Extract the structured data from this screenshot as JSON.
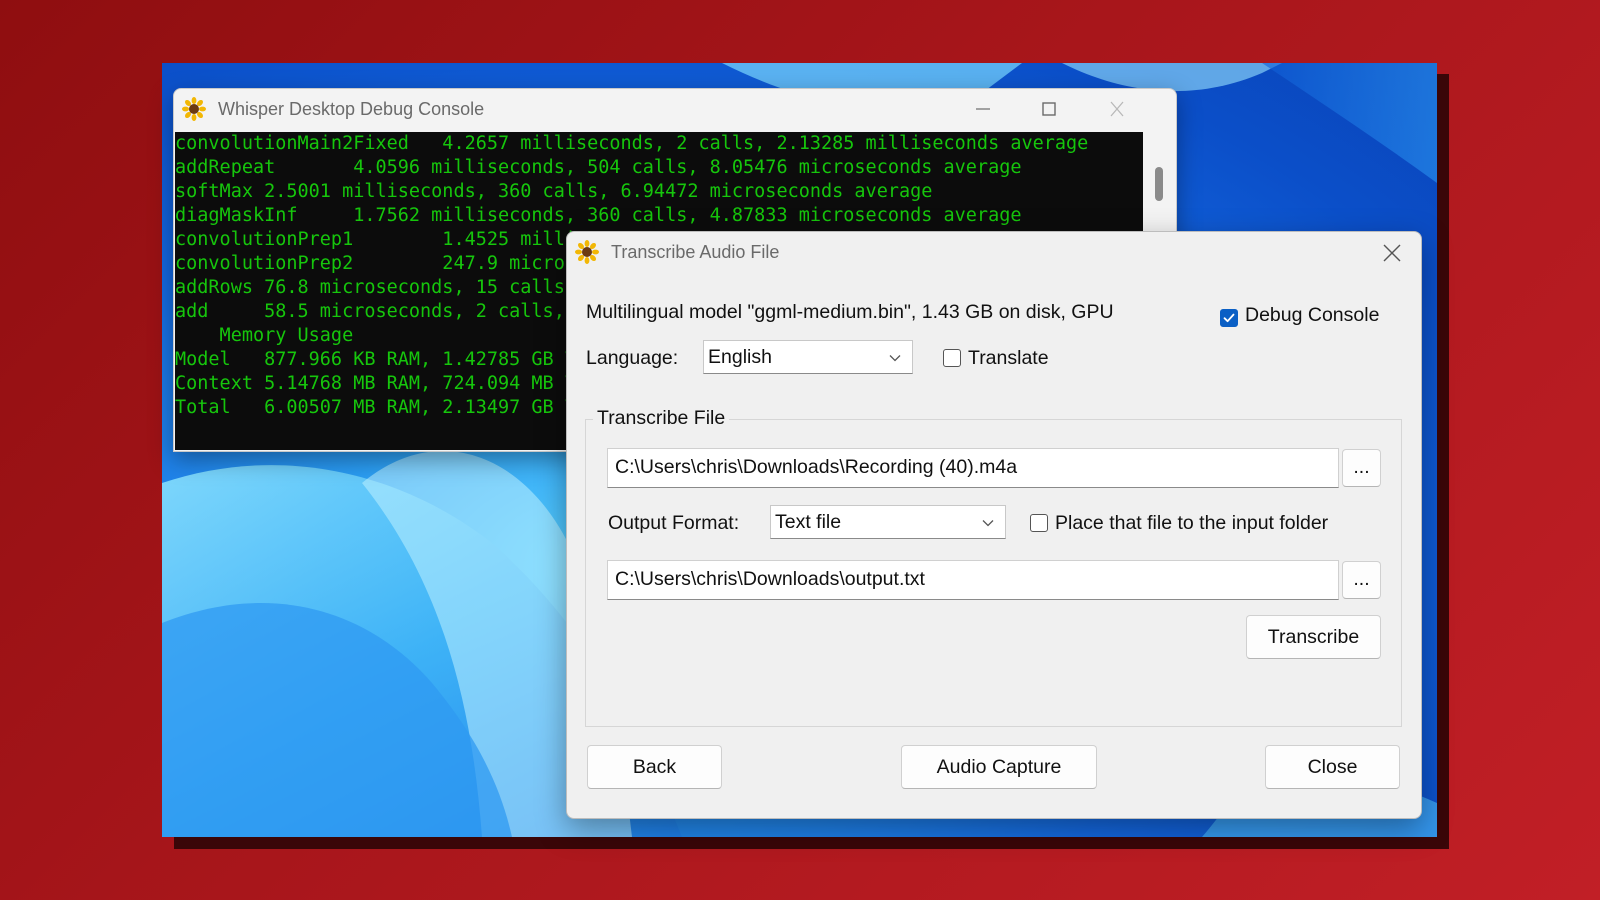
{
  "console": {
    "title": "Whisper Desktop Debug Console",
    "lines": [
      "convolutionMain2Fixed   4.2657 milliseconds, 2 calls, 2.13285 milliseconds average",
      "addRepeat       4.0596 milliseconds, 504 calls, 8.05476 microseconds average",
      "softMax 2.5001 milliseconds, 360 calls, 6.94472 microseconds average",
      "diagMaskInf     1.7562 milliseconds, 360 calls, 4.87833 microseconds average",
      "convolutionPrep1        1.4525 milli",
      "convolutionPrep2        247.9 micros",
      "addRows 76.8 microseconds, 15 calls,",
      "add     58.5 microseconds, 2 calls,",
      "    Memory Usage",
      "Model   877.966 KB RAM, 1.42785 GB V",
      "Context 5.14768 MB RAM, 724.094 MB V",
      "Total   6.00507 MB RAM, 2.13497 GB V"
    ],
    "text_color": "#16c60c",
    "bg_color": "#0c0c0c"
  },
  "dialog": {
    "title": "Transcribe Audio File",
    "model_info": "Multilingual model \"ggml-medium.bin\", 1.43 GB on disk, GPU",
    "debug_console_label": "Debug Console",
    "debug_console_checked": true,
    "language_label": "Language:",
    "language_value": "English",
    "translate_label": "Translate",
    "translate_checked": false,
    "group_title": "Transcribe File",
    "input_path": "C:\\Users\\chris\\Downloads\\Recording (40).m4a",
    "browse_label": "...",
    "output_format_label": "Output Format:",
    "output_format_value": "Text file",
    "place_in_input_label": "Place that file to the input folder",
    "place_in_input_checked": false,
    "output_path": "C:\\Users\\chris\\Downloads\\output.txt",
    "transcribe_label": "Transcribe",
    "back_label": "Back",
    "audio_capture_label": "Audio Capture",
    "close_label": "Close",
    "accent_color": "#0a5fc5"
  },
  "icons": [
    "sunflower-icon",
    "minimize-icon",
    "maximize-icon",
    "close-icon",
    "chevron-down-icon",
    "checkmark-icon"
  ]
}
